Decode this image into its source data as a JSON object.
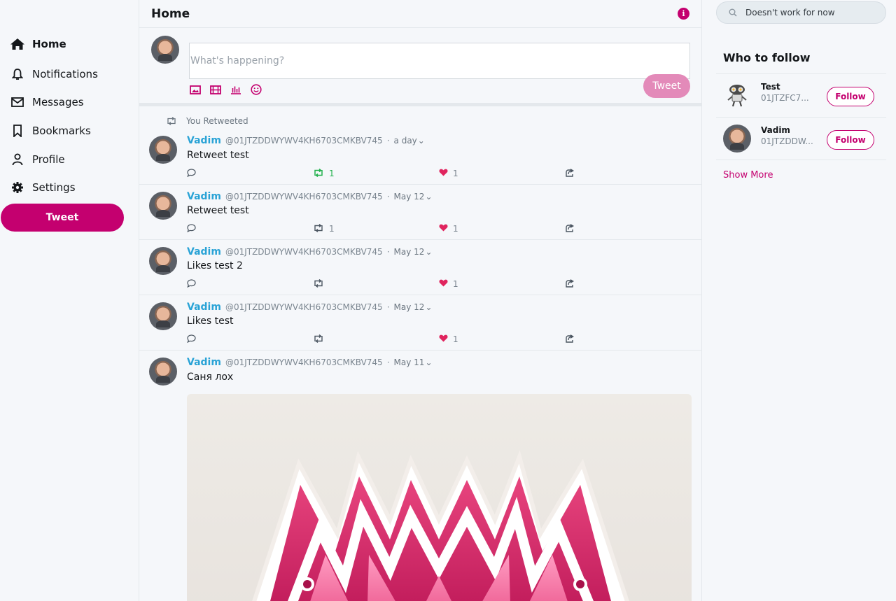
{
  "sidebar": {
    "items": [
      {
        "label": "Home",
        "icon": "home-icon"
      },
      {
        "label": "Notifications",
        "icon": "bell-icon"
      },
      {
        "label": "Messages",
        "icon": "envelope-icon"
      },
      {
        "label": "Bookmarks",
        "icon": "bookmark-icon"
      },
      {
        "label": "Profile",
        "icon": "user-icon"
      },
      {
        "label": "Settings",
        "icon": "gear-icon"
      }
    ],
    "tweet_button": "Tweet"
  },
  "header": {
    "title": "Home"
  },
  "compose": {
    "placeholder": "What's happening?",
    "button": "Tweet"
  },
  "feed": [
    {
      "retweet_banner": "You Retweeted",
      "name": "Vadim",
      "handle": "@01JTZDDWYWV4KH6703CMKBV745",
      "time": "a day",
      "text": "Retweet test",
      "retweets": "1",
      "likes": "1"
    },
    {
      "name": "Vadim",
      "handle": "@01JTZDDWYWV4KH6703CMKBV745",
      "time": "May 12",
      "text": "Retweet test",
      "retweets": "1",
      "likes": "1"
    },
    {
      "name": "Vadim",
      "handle": "@01JTZDDWYWV4KH6703CMKBV745",
      "time": "May 12",
      "text": "Likes test 2",
      "retweets": "",
      "likes": "1"
    },
    {
      "name": "Vadim",
      "handle": "@01JTZDDWYWV4KH6703CMKBV745",
      "time": "May 12",
      "text": "Likes test",
      "retweets": "",
      "likes": "1"
    },
    {
      "name": "Vadim",
      "handle": "@01JTZDDWYWV4KH6703CMKBV745",
      "time": "May 11",
      "text": "Саня лох"
    }
  ],
  "search": {
    "placeholder": "Doesn't work for now"
  },
  "who_to_follow": {
    "title": "Who to follow",
    "users": [
      {
        "name": "Test",
        "handle": "01JTZFC7...",
        "button": "Follow"
      },
      {
        "name": "Vadim",
        "handle": "01JTZDDW...",
        "button": "Follow"
      }
    ],
    "show_more": "Show More"
  },
  "colors": {
    "accent": "#c4006f",
    "link": "#2aa3d6",
    "retweet_active": "#22b14c",
    "like": "#e0245e"
  }
}
